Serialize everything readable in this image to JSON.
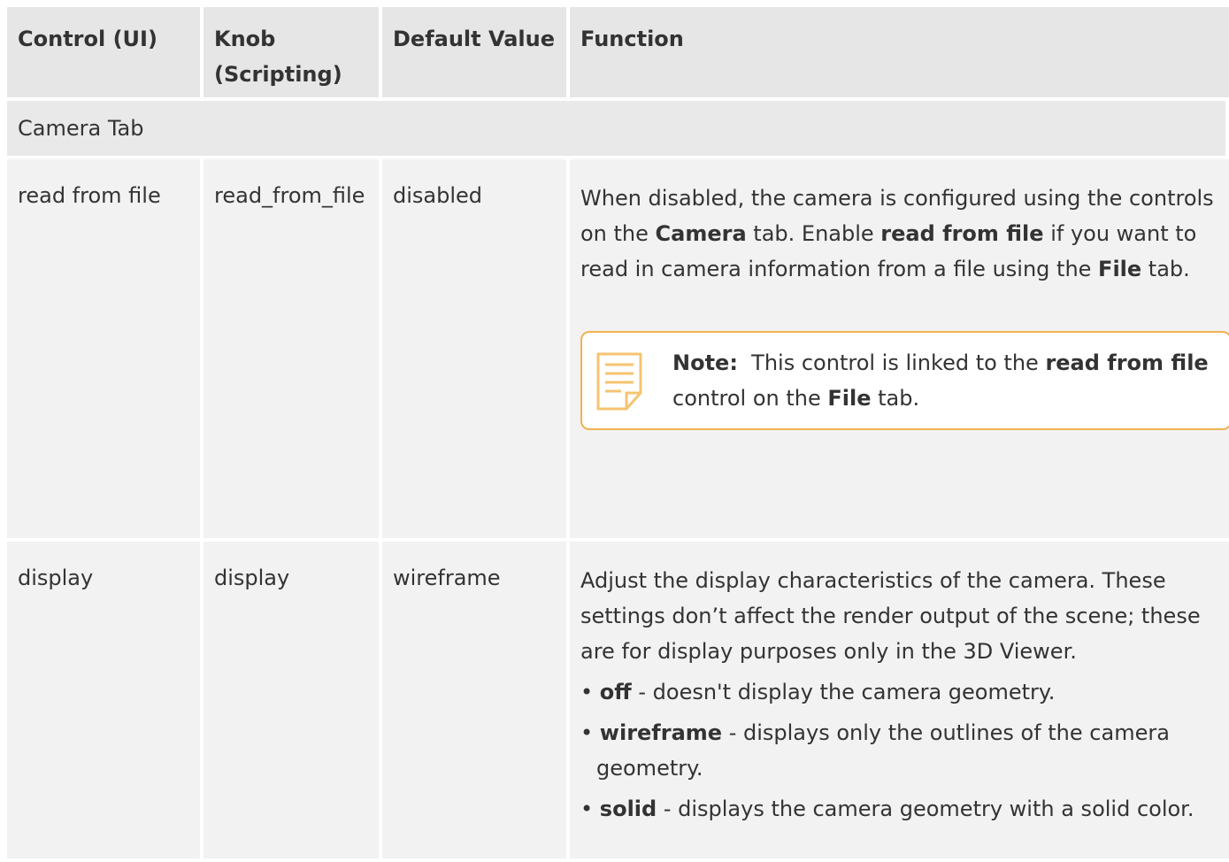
{
  "table": {
    "headers": {
      "control": "Control (UI)",
      "knob": "Knob (Scripting)",
      "default": "Default Value",
      "function": "Function"
    },
    "section": "Camera Tab",
    "rows": [
      {
        "control": "read from file",
        "knob": "read_from_file",
        "default": "disabled",
        "function": {
          "p1_a": "When disabled, the camera is configured using the controls on the ",
          "p1_b": "Camera",
          "p1_c": " tab. Enable ",
          "p1_d": "read from file",
          "p1_e": " if you want to read in camera information from a file using the ",
          "p1_f": "File",
          "p1_g": " tab.",
          "note": {
            "label": "Note:",
            "a": "  This control is linked to the ",
            "b": "read from file",
            "c": " control on the ",
            "d": "File",
            "e": " tab.",
            "icon": "note-icon"
          }
        }
      },
      {
        "control": "display",
        "knob": "display",
        "default": "wireframe",
        "function": {
          "intro": "Adjust the display characteristics of the camera. These settings don’t affect the render output of the scene; these are for display purposes only in the 3D Viewer.",
          "bullets": [
            {
              "term": "off",
              "desc": " - doesn't display the camera geometry."
            },
            {
              "term": "wireframe",
              "desc": " - displays only the outlines of the camera geometry."
            },
            {
              "term": "solid",
              "desc": " - displays the camera geometry with a solid color."
            }
          ]
        }
      }
    ]
  },
  "colors": {
    "header_bg": "#e6e6e6",
    "row_bg": "#f2f2f2",
    "note_border": "#f0b251"
  }
}
